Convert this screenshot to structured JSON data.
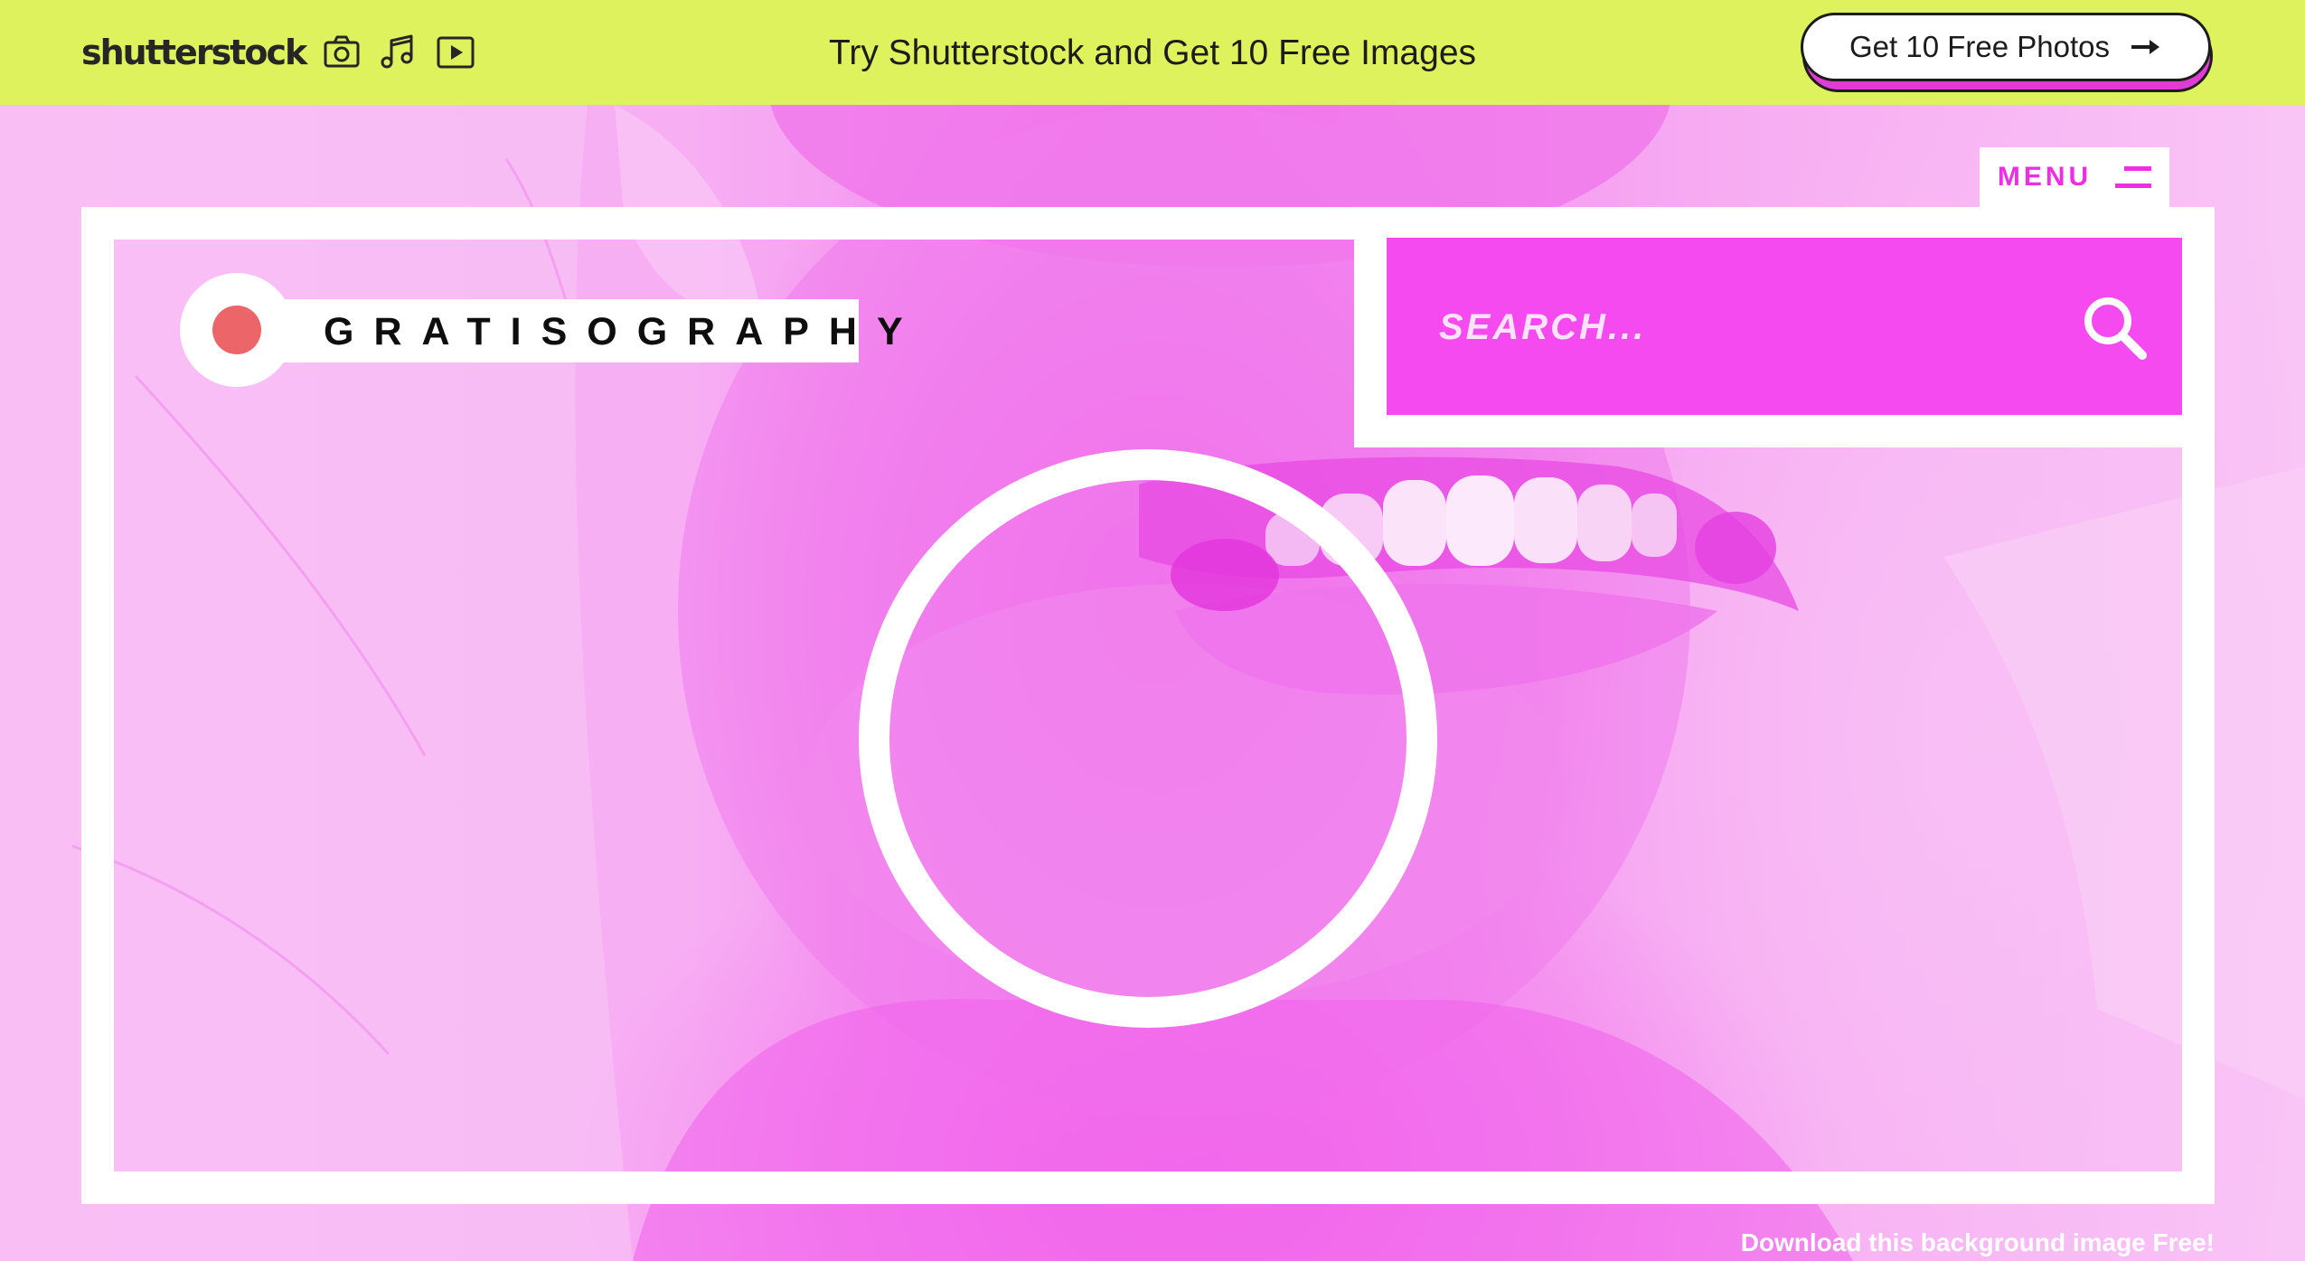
{
  "promo_bar": {
    "logo_text": "shutterstock",
    "logo_mark": "·",
    "icons": [
      "camera-icon",
      "music-note-icon",
      "video-play-icon"
    ],
    "headline": "Try Shutterstock and Get 10 Free Images",
    "cta_label": "Get 10 Free Photos",
    "cta_icon": "arrow-right-icon",
    "background": "#def25e",
    "cta_shadow_color": "#e13bd6"
  },
  "header": {
    "menu_label": "MENU",
    "menu_icon": "hamburger-icon"
  },
  "brand": {
    "name": "GRATISOGRAPHY",
    "dot_color": "#ec6569"
  },
  "search": {
    "placeholder": "SEARCH...",
    "value": "",
    "icon": "search-icon",
    "background": "#f54af0"
  },
  "hero": {
    "tint": "#f27fee",
    "download_text": "Download this background image Free!"
  }
}
